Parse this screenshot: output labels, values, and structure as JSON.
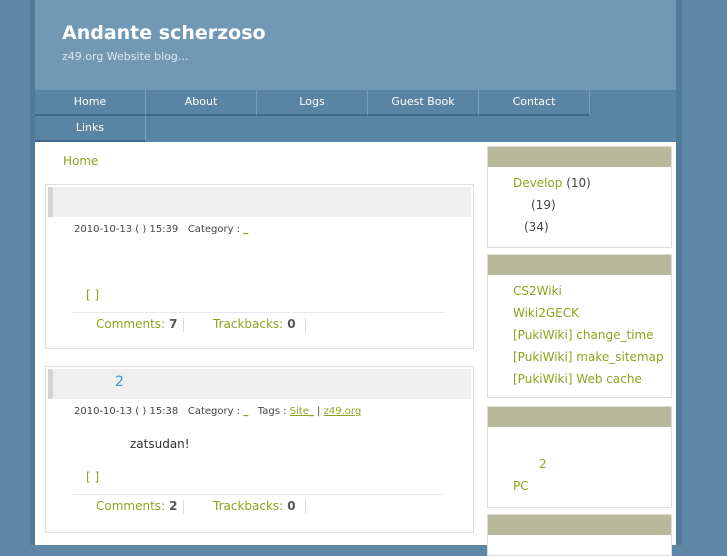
{
  "site": {
    "title": "Andante scherzoso",
    "description": "z49.org  Website    blog..."
  },
  "nav": {
    "items": [
      "Home",
      "About",
      "Logs",
      "Guest Book",
      "Contact",
      "Links"
    ]
  },
  "breadcrumb": "Home",
  "posts": [
    {
      "title": "",
      "date": "2010-10-13 ( ) 15:39",
      "category_label": "Category :",
      "category_value": "_",
      "body": "",
      "bracket": "[    ]",
      "comments_label": "Comments:",
      "comments_count": "7",
      "trackbacks_label": "Trackbacks:",
      "trackbacks_count": "0"
    },
    {
      "title": "2",
      "date": "2010-10-13 ( ) 15:38",
      "category_label": "Category :",
      "category_value": "_",
      "tags_label": "Tags :",
      "tags": [
        "Site_",
        "z49.org"
      ],
      "body": "zatsudan!",
      "bracket": "[    ]",
      "comments_label": "Comments:",
      "comments_count": "2",
      "trackbacks_label": "Trackbacks:",
      "trackbacks_count": "0"
    }
  ],
  "sidebar": {
    "categories": [
      {
        "label": "Develop",
        "count": "(10)"
      },
      {
        "label": "",
        "count": "(19)"
      },
      {
        "label": "",
        "count": "(34)"
      }
    ],
    "recent": [
      "CS2Wiki",
      "Wiki2GECK",
      "[PukiWiki] change_time",
      "[PukiWiki] make_sitemap",
      "[PukiWiki] Web cache"
    ],
    "links": [
      "2",
      "PC"
    ]
  }
}
